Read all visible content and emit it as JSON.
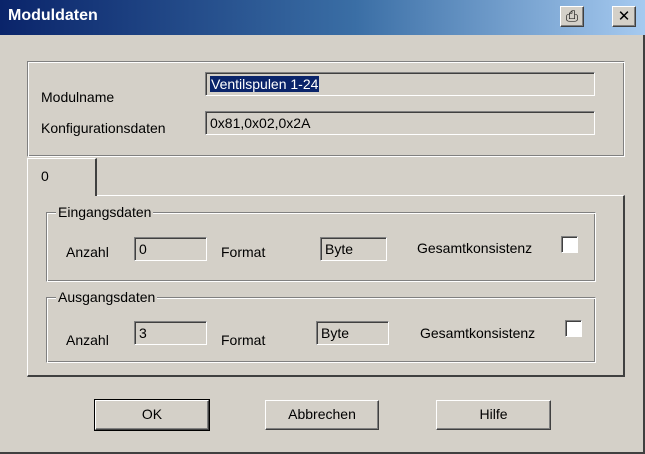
{
  "window": {
    "title": "Moduldaten",
    "print_icon": "⎙",
    "close_icon": "✕"
  },
  "module": {
    "name_label": "Modulname",
    "name_value": "Ventilspulen 1-24",
    "config_label": "Konfigurationsdaten",
    "config_value": "0x81,0x02,0x2A"
  },
  "tabs": [
    {
      "label": "0"
    }
  ],
  "input_group": {
    "title": "Eingangsdaten",
    "count_label": "Anzahl",
    "count_value": "0",
    "format_label": "Format",
    "format_value": "Byte",
    "consistency_label": "Gesamtkonsistenz",
    "consistency_checked": false
  },
  "output_group": {
    "title": "Ausgangsdaten",
    "count_label": "Anzahl",
    "count_value": "3",
    "format_label": "Format",
    "format_value": "Byte",
    "consistency_label": "Gesamtkonsistenz",
    "consistency_checked": false
  },
  "buttons": {
    "ok": "OK",
    "cancel": "Abbrechen",
    "help": "Hilfe"
  },
  "colors": {
    "face": "#d4d0c8",
    "title_start": "#0a246a",
    "title_end": "#a6caf0",
    "selection": "#0a246a"
  }
}
